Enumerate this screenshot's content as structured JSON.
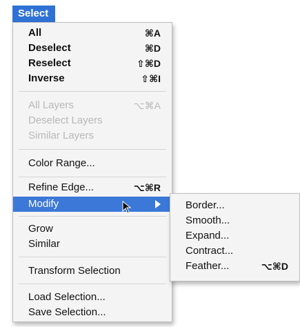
{
  "menubar": {
    "title": "Select"
  },
  "menu": {
    "items": [
      {
        "label": "All",
        "shortcut": "⌘A",
        "state": "enabled"
      },
      {
        "label": "Deselect",
        "shortcut": "⌘D",
        "state": "enabled"
      },
      {
        "label": "Reselect",
        "shortcut": "⇧⌘D",
        "state": "enabled"
      },
      {
        "label": "Inverse",
        "shortcut": "⇧⌘I",
        "state": "enabled"
      },
      {
        "label": "All Layers",
        "shortcut": "⌥⌘A",
        "state": "disabled"
      },
      {
        "label": "Deselect Layers",
        "shortcut": "",
        "state": "disabled"
      },
      {
        "label": "Similar Layers",
        "shortcut": "",
        "state": "disabled"
      },
      {
        "label": "Color Range...",
        "shortcut": "",
        "state": "enabled"
      },
      {
        "label": "Refine Edge...",
        "shortcut": "⌥⌘R",
        "state": "enabled"
      },
      {
        "label": "Modify",
        "shortcut": "",
        "state": "highlighted"
      },
      {
        "label": "Grow",
        "shortcut": "",
        "state": "enabled"
      },
      {
        "label": "Similar",
        "shortcut": "",
        "state": "enabled"
      },
      {
        "label": "Transform Selection",
        "shortcut": "",
        "state": "enabled"
      },
      {
        "label": "Load Selection...",
        "shortcut": "",
        "state": "enabled"
      },
      {
        "label": "Save Selection...",
        "shortcut": "",
        "state": "enabled"
      }
    ]
  },
  "submenu": {
    "items": [
      {
        "label": "Border...",
        "shortcut": ""
      },
      {
        "label": "Smooth...",
        "shortcut": ""
      },
      {
        "label": "Expand...",
        "shortcut": ""
      },
      {
        "label": "Contract...",
        "shortcut": ""
      },
      {
        "label": "Feather...",
        "shortcut": "⌥⌘D"
      }
    ]
  },
  "colors": {
    "highlight": "#3b78d8",
    "menubar_selected": "#2f72d6",
    "disabled_text": "#b8b8b8",
    "menu_background": "#f4f4f4"
  },
  "icons": {
    "cursor": "arrow-cursor-icon",
    "submenu_indicator": "submenu-triangle-icon"
  }
}
